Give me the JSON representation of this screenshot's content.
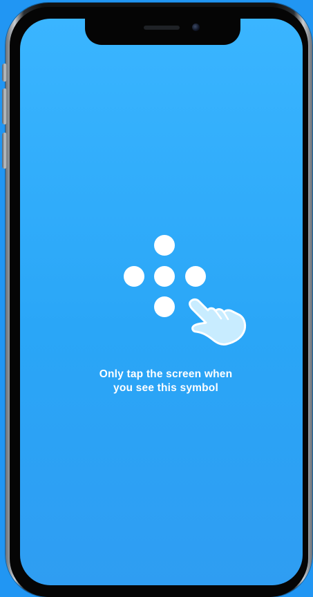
{
  "screen": {
    "instruction_line1": "Only tap the screen when",
    "instruction_line2": "you see this symbol",
    "symbol_icon": "dot-cross-with-tap-hand-icon"
  },
  "colors": {
    "page_background": "#2196f3",
    "screen_top": "#3ab5ff",
    "screen_bottom": "#2f9df2",
    "symbol": "#ffffff",
    "hand_fill": "#c8ecff"
  }
}
